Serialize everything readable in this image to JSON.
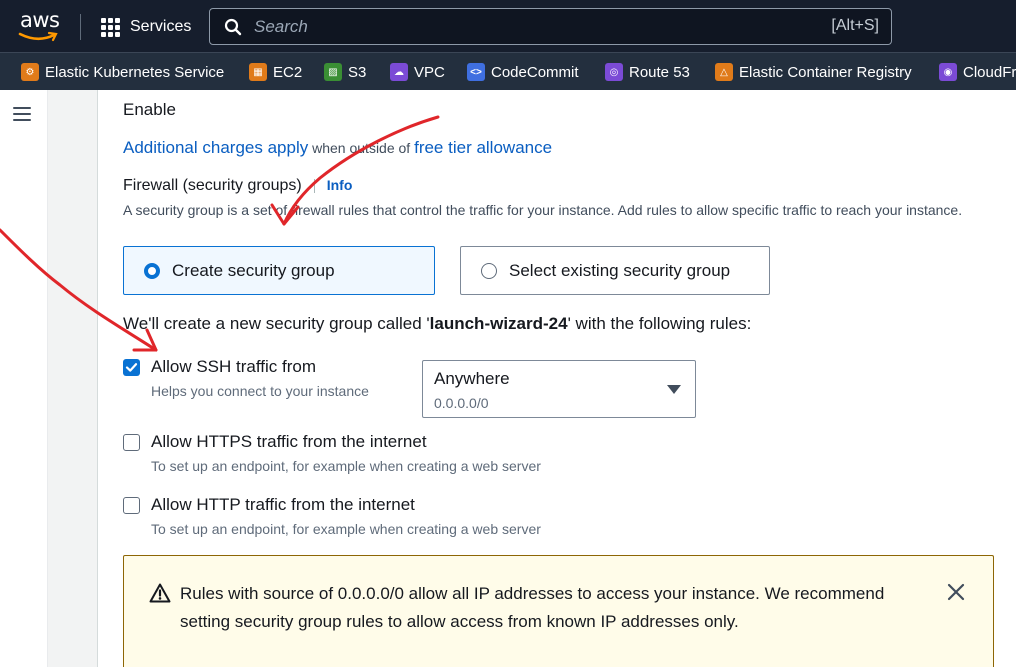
{
  "topnav": {
    "logo_text": "aws",
    "services_label": "Services",
    "search_placeholder": "Search",
    "search_shortcut": "[Alt+S]"
  },
  "favorites": [
    {
      "label": "Elastic Kubernetes Service",
      "icon": "kubernetes-icon",
      "color": "#e07b1a"
    },
    {
      "label": "EC2",
      "icon": "ec2-icon",
      "color": "#e07b1a"
    },
    {
      "label": "S3",
      "icon": "s3-bucket-icon",
      "color": "#3a8e34"
    },
    {
      "label": "VPC",
      "icon": "vpc-icon",
      "color": "#7b4bd6"
    },
    {
      "label": "CodeCommit",
      "icon": "codecommit-icon",
      "color": "#3f6fe0"
    },
    {
      "label": "Route 53",
      "icon": "route53-icon",
      "color": "#7b4bd6"
    },
    {
      "label": "Elastic Container Registry",
      "icon": "ecr-icon",
      "color": "#e07b1a"
    },
    {
      "label": "CloudFr",
      "icon": "cloudfront-icon",
      "color": "#7b4bd6"
    }
  ],
  "content": {
    "enable_text": "Enable",
    "charges": {
      "link": "Additional charges apply",
      "middle": " when outside of ",
      "allowance_link": "free tier allowance"
    },
    "firewall": {
      "title": "Firewall (security groups)",
      "info": "Info",
      "description": "A security group is a set of firewall rules that control the traffic for your instance. Add rules to allow specific traffic to reach your instance."
    },
    "tiles": {
      "create": "Create security group",
      "existing": "Select existing security group"
    },
    "notice": {
      "prefix": "We'll create a new security group called '",
      "name": "launch-wizard-24",
      "suffix": "' with the following rules:"
    },
    "rules": {
      "ssh": {
        "label": "Allow SSH traffic from",
        "help": "Helps you connect to your instance",
        "checked": true
      },
      "https": {
        "label": "Allow HTTPS traffic from the internet",
        "help": "To set up an endpoint, for example when creating a web server",
        "checked": false
      },
      "http": {
        "label": "Allow HTTP traffic from the internet",
        "help": "To set up an endpoint, for example when creating a web server",
        "checked": false
      }
    },
    "ssh_source": {
      "value": "Anywhere",
      "cidr": "0.0.0.0/0"
    },
    "alert": {
      "message": "Rules with source of 0.0.0.0/0 allow all IP addresses to access your instance. We recommend setting security group rules to allow access from known IP addresses only."
    }
  },
  "colors": {
    "nav_bg": "#161e2d",
    "favbar_bg": "#232f3e",
    "accent": "#0972d3",
    "link": "#0a5ec1",
    "warning_bg": "#fffce9",
    "annotation": "#e0262a"
  }
}
